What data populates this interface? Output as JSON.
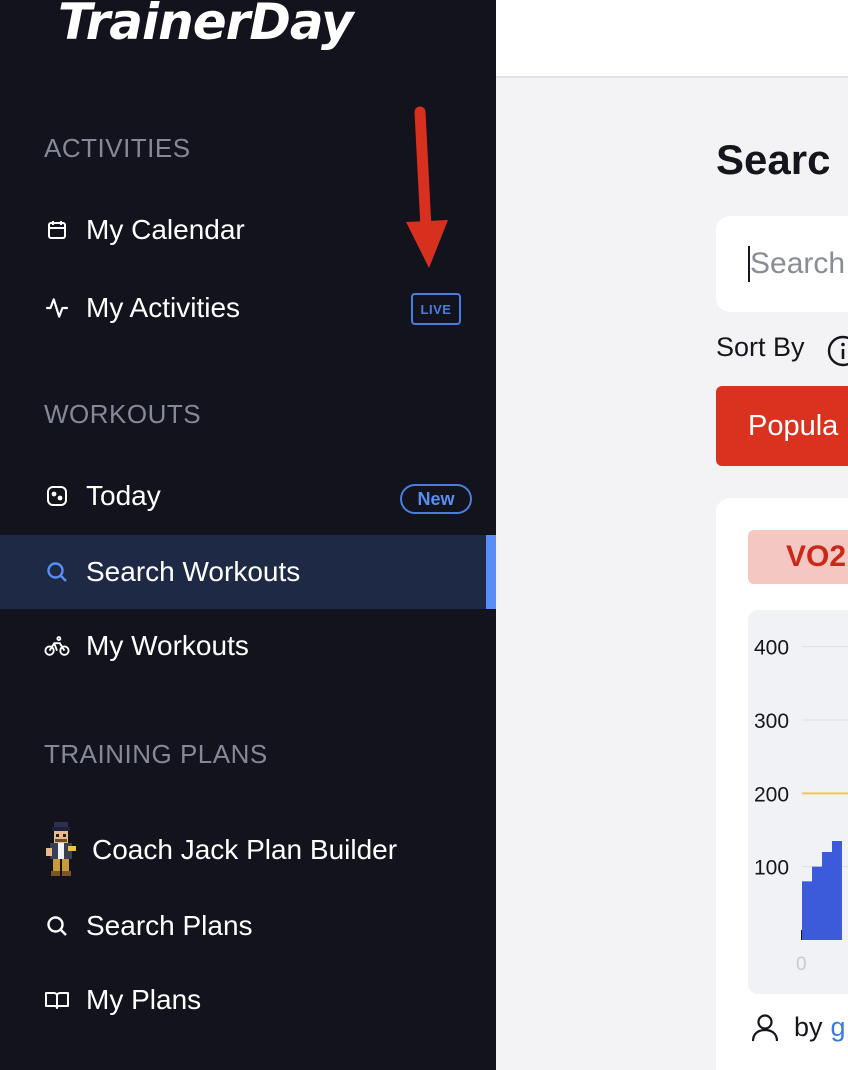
{
  "app": {
    "logo": "TrainerDay"
  },
  "sidebar": {
    "sections": {
      "activities": "ACTIVITIES",
      "workouts": "WORKOUTS",
      "training_plans": "TRAINING PLANS"
    },
    "items": [
      {
        "label": "My Calendar",
        "icon": "calendar-icon"
      },
      {
        "label": "My Activities",
        "icon": "activity-pulse-icon",
        "badge": "LIVE"
      },
      {
        "label": "Today",
        "icon": "today-icon",
        "badge": "New"
      },
      {
        "label": "Search Workouts",
        "icon": "search-icon",
        "active": true
      },
      {
        "label": "My Workouts",
        "icon": "bicycle-icon"
      },
      {
        "label": "Coach Jack Plan Builder",
        "icon": "coach-jack-avatar"
      },
      {
        "label": "Search Plans",
        "icon": "search-icon"
      },
      {
        "label": "My Plans",
        "icon": "book-icon"
      }
    ]
  },
  "main": {
    "title": "Searc",
    "search": {
      "placeholder": "Search"
    },
    "sort": {
      "label": "Sort By",
      "active_option": "Popula"
    },
    "card": {
      "tag": "VO2",
      "byline": {
        "by": "by",
        "author": "g"
      }
    }
  },
  "colors": {
    "sidebar_bg": "#12131c",
    "active_bg": "#1e2a45",
    "accent": "#5a8ef5",
    "primary_red": "#d9321f",
    "tag_bg": "#f4c7c2",
    "bar_blue": "#3b5bdb",
    "ftp_line": "#f2c94c"
  },
  "chart_data": {
    "type": "bar",
    "y_ticks": [
      "400",
      "300",
      "200",
      "100"
    ],
    "x_ticks": [
      "0"
    ],
    "ylim": [
      0,
      450
    ],
    "reference_line": {
      "value": 200,
      "color": "#f2c94c"
    },
    "steps": [
      {
        "value": 80
      },
      {
        "value": 100
      },
      {
        "value": 120
      },
      {
        "value": 135
      }
    ]
  }
}
